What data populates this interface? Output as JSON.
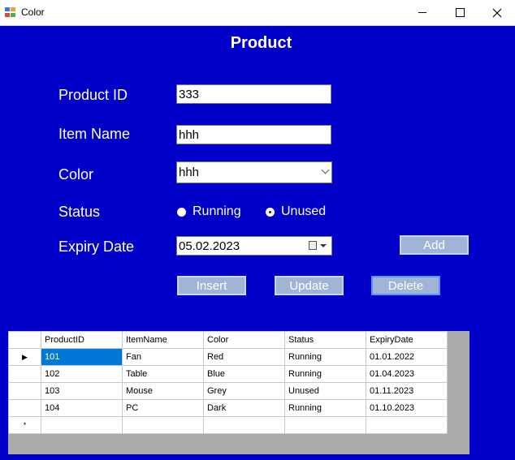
{
  "window": {
    "title": "Color"
  },
  "form": {
    "header": "Product",
    "labels": {
      "product_id": "Product ID",
      "item_name": "Item Name",
      "color": "Color",
      "status": "Status",
      "expiry_date": "Expiry Date"
    },
    "values": {
      "product_id": "333",
      "item_name": "hhh",
      "color": "hhh",
      "expiry_date": "05.02.2023"
    },
    "status_options": [
      "Running",
      "Unused"
    ],
    "status_selected": "Unused",
    "buttons": {
      "add": "Add",
      "insert": "Insert",
      "update": "Update",
      "delete": "Delete"
    }
  },
  "grid": {
    "columns": [
      "ProductID",
      "ItemName",
      "Color",
      "Status",
      "ExpiryDate"
    ],
    "rows": [
      [
        "101",
        "Fan",
        "Red",
        "Running",
        "01.01.2022"
      ],
      [
        "102",
        "Table",
        "Blue",
        "Running",
        "01.04.2023"
      ],
      [
        "103",
        "Mouse",
        "Grey",
        "Unused",
        "01.11.2023"
      ],
      [
        "104",
        "PC",
        "Dark",
        "Running",
        "01.10.2023"
      ]
    ],
    "current_row_glyph": "▶",
    "new_row_glyph": "*"
  }
}
